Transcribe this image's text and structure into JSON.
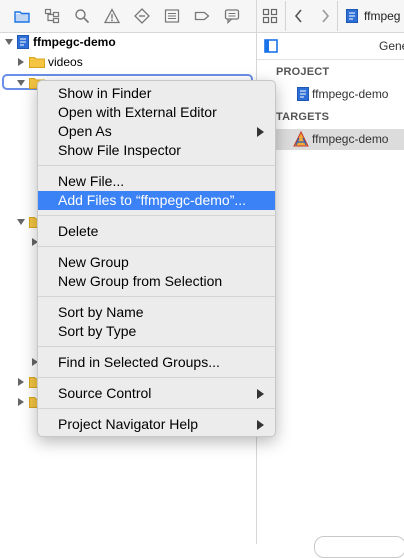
{
  "navigator": {
    "toolbar_icons": [
      "folder-icon",
      "hierarchy-icon",
      "search-icon",
      "warning-icon",
      "test-diamond-icon",
      "list-icon",
      "tag-icon",
      "comment-icon"
    ],
    "project_name": "ffmpegc-demo",
    "items": [
      {
        "label": "videos"
      },
      {
        "label": ""
      }
    ]
  },
  "editor": {
    "breadcrumb": "ffmpeg",
    "sub_label": "Gene",
    "project_header": "PROJECT",
    "project_item": "ffmpegc-demo",
    "targets_header": "TARGETS",
    "target_item": "ffmpegc-demo"
  },
  "context_menu": {
    "items": [
      {
        "label": "Show in Finder"
      },
      {
        "label": "Open with External Editor"
      },
      {
        "label": "Open As"
      },
      {
        "label": "Show File Inspector"
      },
      {
        "label": "New File..."
      },
      {
        "label": "Add Files to “ffmpegc-demo”..."
      },
      {
        "label": "Delete"
      },
      {
        "label": "New Group"
      },
      {
        "label": "New Group from Selection"
      },
      {
        "label": "Sort by Name"
      },
      {
        "label": "Sort by Type"
      },
      {
        "label": "Find in Selected Groups..."
      },
      {
        "label": "Source Control"
      },
      {
        "label": "Project Navigator Help"
      }
    ]
  },
  "colors": {
    "highlight": "#3b82f6",
    "folder": "#f5c542",
    "accent_blue": "#1a73e8"
  }
}
